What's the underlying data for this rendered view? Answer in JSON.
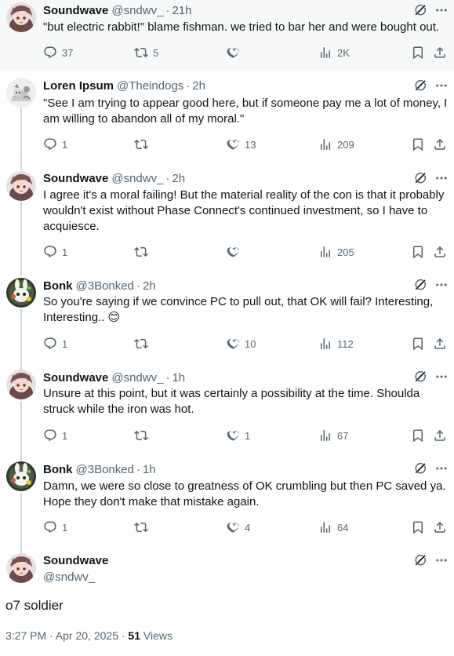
{
  "replies": [
    {
      "name": "Soundwave",
      "handle": "@sndwv_",
      "time": "21h",
      "avatar": "soundwave-avatar",
      "text": "\"but electric rabbit!\" blame fishman. we tried to bar her and were bought out.",
      "reply_count": "37",
      "repost_count": "5",
      "like_count": "",
      "view_count": "2K"
    },
    {
      "name": "Loren Ipsum",
      "handle": "@Theindogs",
      "time": "2h",
      "avatar": "loren-avatar",
      "text": "\"See I am trying to appear good here, but if someone pay me a lot of money, I am willing to abandon all of my moral.\"",
      "reply_count": "1",
      "repost_count": "",
      "like_count": "13",
      "view_count": "209"
    },
    {
      "name": "Soundwave",
      "handle": "@sndwv_",
      "time": "2h",
      "avatar": "soundwave-avatar",
      "text": "I agree it's a moral failing! But the material reality of the con is that it probably wouldn't exist without Phase Connect's continued investment, so I have to acquiesce.",
      "reply_count": "1",
      "repost_count": "",
      "like_count": "",
      "view_count": "205"
    },
    {
      "name": "Bonk",
      "handle": "@3Bonked",
      "time": "2h",
      "avatar": "bonk-avatar",
      "text": "So you're saying if we convince PC to pull out, that OK will fail? Interesting, Interesting.. 😊",
      "reply_count": "1",
      "repost_count": "",
      "like_count": "10",
      "view_count": "112"
    },
    {
      "name": "Soundwave",
      "handle": "@sndwv_",
      "time": "1h",
      "avatar": "soundwave-avatar",
      "text": "Unsure at this point, but it was certainly a possibility at the time. Shoulda struck while the iron was hot.",
      "reply_count": "1",
      "repost_count": "",
      "like_count": "1",
      "view_count": "67"
    },
    {
      "name": "Bonk",
      "handle": "@3Bonked",
      "time": "1h",
      "avatar": "bonk-avatar",
      "text": "Damn, we were so close to greatness of OK crumbling but then PC saved ya. Hope they don't make that mistake again.",
      "reply_count": "1",
      "repost_count": "",
      "like_count": "4",
      "view_count": "64"
    }
  ],
  "main_tweet": {
    "name": "Soundwave",
    "handle": "@sndwv_",
    "avatar": "soundwave-avatar",
    "text": "o7 soldier",
    "timestamp": "3:27 PM · Apr 20, 2025 · ",
    "views_count": "51",
    "views_label": " Views"
  },
  "icons": {
    "reply": "reply-icon",
    "repost": "repost-icon",
    "like": "heart-icon",
    "views": "views-icon",
    "bookmark": "bookmark-icon",
    "share": "share-icon",
    "grok": "grok-icon",
    "more": "more-icon"
  },
  "colors": {
    "text_primary": "#0f1419",
    "text_secondary": "#536471",
    "thread_line": "#cfd9de",
    "highlight_bg": "#f7f9f9"
  }
}
